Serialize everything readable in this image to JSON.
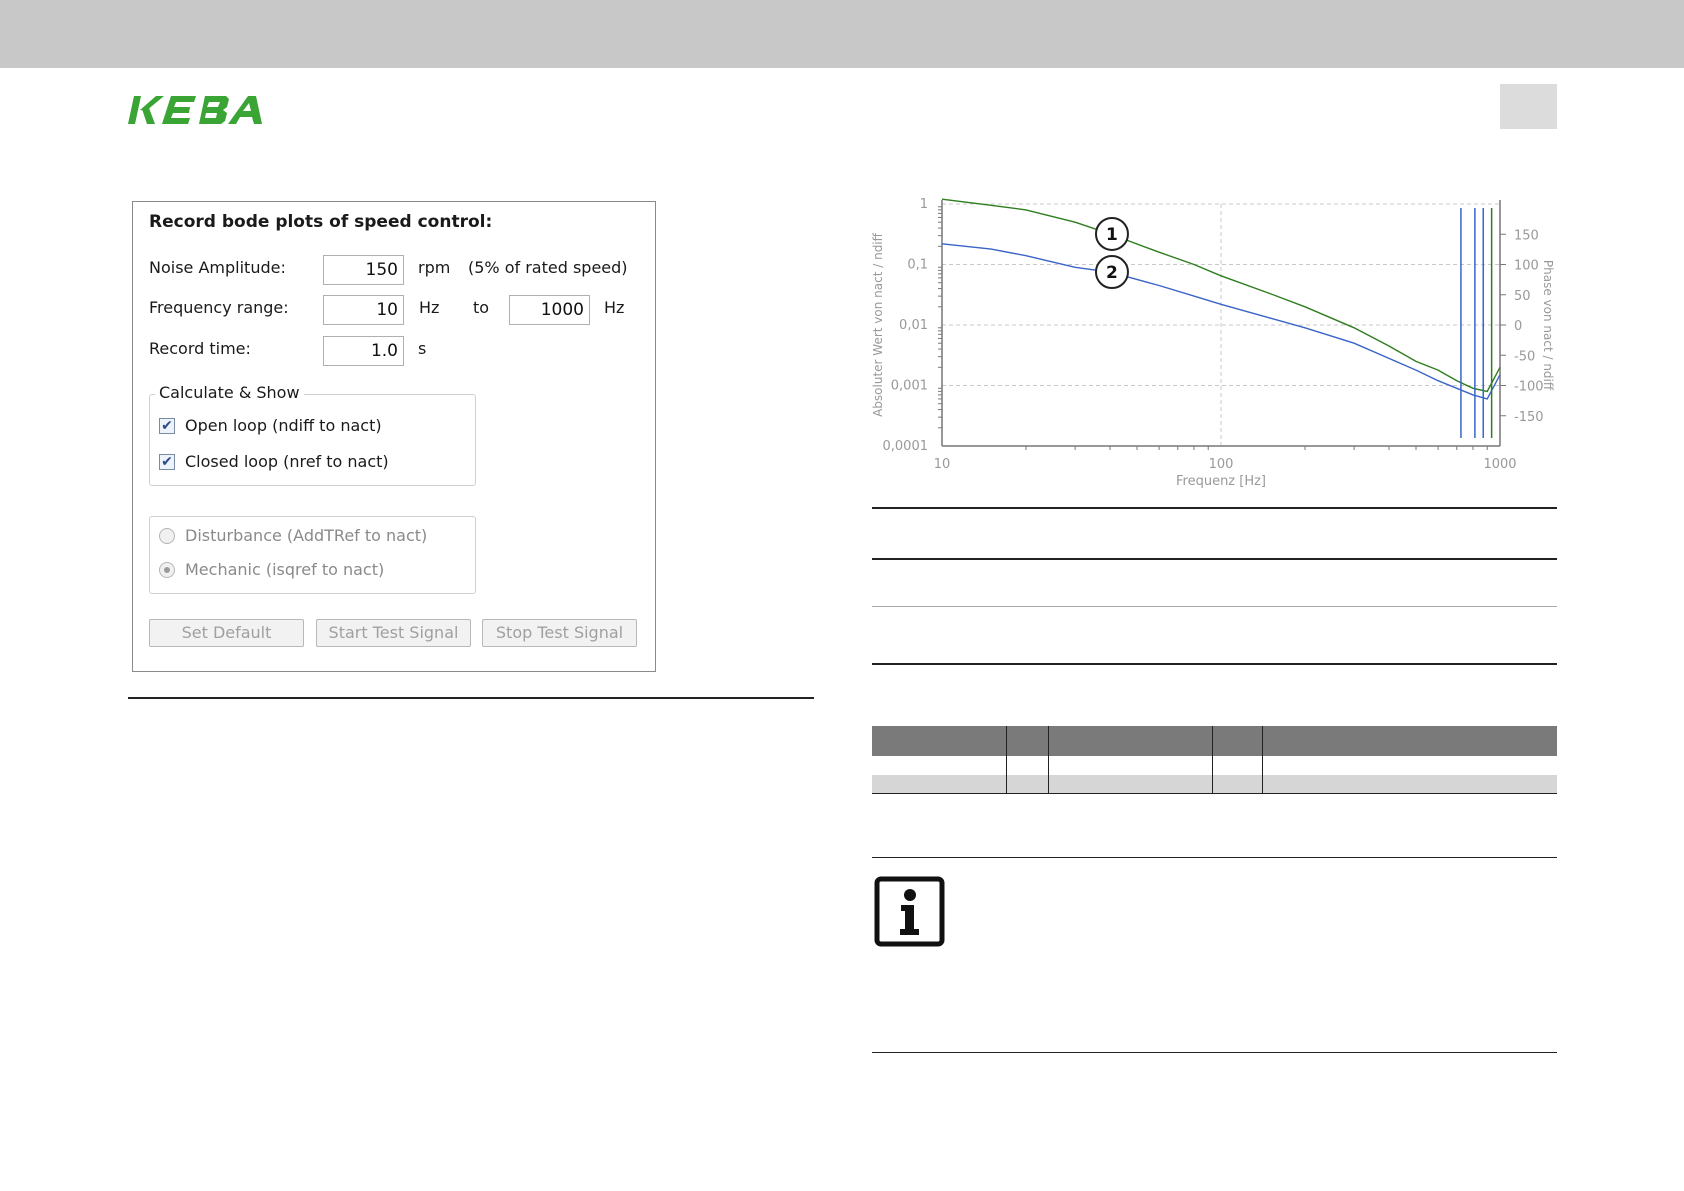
{
  "header": {
    "logo_text": "KEBA",
    "brand_color": "#3aa435"
  },
  "dialog": {
    "title": "Record bode plots of speed control:",
    "noise_label": "Noise Amplitude:",
    "noise_value": "150",
    "noise_unit": "rpm",
    "noise_note": "(5% of rated speed)",
    "freq_label": "Frequency range:",
    "freq_from": "10",
    "freq_from_unit": "Hz",
    "freq_to_label": "to",
    "freq_to": "1000",
    "freq_to_unit": "Hz",
    "time_label": "Record time:",
    "time_value": "1.0",
    "time_unit": "s",
    "group_title": "Calculate & Show",
    "options": [
      {
        "label": "Open loop (ndiff to nact)",
        "checked": true
      },
      {
        "label": "Closed loop (nref to nact)",
        "checked": true
      }
    ],
    "radios": [
      {
        "label": "Disturbance (AddTRef to nact)",
        "selected": false
      },
      {
        "label": "Mechanic (isqref to nact)",
        "selected": true
      }
    ],
    "buttons": [
      "Set Default",
      "Start Test Signal",
      "Stop Test Signal"
    ]
  },
  "chart_data": {
    "type": "line",
    "xlabel": "Frequenz [Hz]",
    "ylabel_left": "Absoluter Wert von nact / ndiff",
    "ylabel_right": "Phase von nact / ndiff",
    "x_scale": "log",
    "xlim": [
      10,
      1000
    ],
    "x_ticks": [
      "10",
      "100",
      "1000"
    ],
    "y_scale_left": "log",
    "ylim_left": [
      0.0001,
      1
    ],
    "y_ticks_left": [
      "1",
      "0,1",
      "0,01",
      "0,001",
      "0,0001"
    ],
    "ylim_right": [
      -200,
      200
    ],
    "y_ticks_right": [
      "150",
      "100",
      "50",
      "0",
      "-50",
      "-100",
      "-150"
    ],
    "grid": true,
    "annotations": [
      "1",
      "2"
    ],
    "series": [
      {
        "color": "#2e7d1e",
        "x": [
          10,
          15,
          20,
          30,
          40,
          60,
          80,
          100,
          150,
          200,
          300,
          400,
          500,
          600,
          700,
          800,
          900,
          1000
        ],
        "y": [
          1.2,
          0.95,
          0.8,
          0.5,
          0.32,
          0.16,
          0.1,
          0.065,
          0.033,
          0.02,
          0.009,
          0.0045,
          0.0025,
          0.0018,
          0.0012,
          0.0009,
          0.0008,
          0.002
        ]
      },
      {
        "color": "#3a64c8",
        "x": [
          10,
          15,
          20,
          30,
          40,
          60,
          80,
          100,
          150,
          200,
          300,
          400,
          500,
          600,
          700,
          800,
          900,
          1000
        ],
        "y": [
          0.22,
          0.18,
          0.14,
          0.09,
          0.075,
          0.045,
          0.03,
          0.022,
          0.013,
          0.009,
          0.005,
          0.0028,
          0.0018,
          0.0012,
          0.0009,
          0.0007,
          0.0006,
          0.0015
        ]
      }
    ]
  }
}
